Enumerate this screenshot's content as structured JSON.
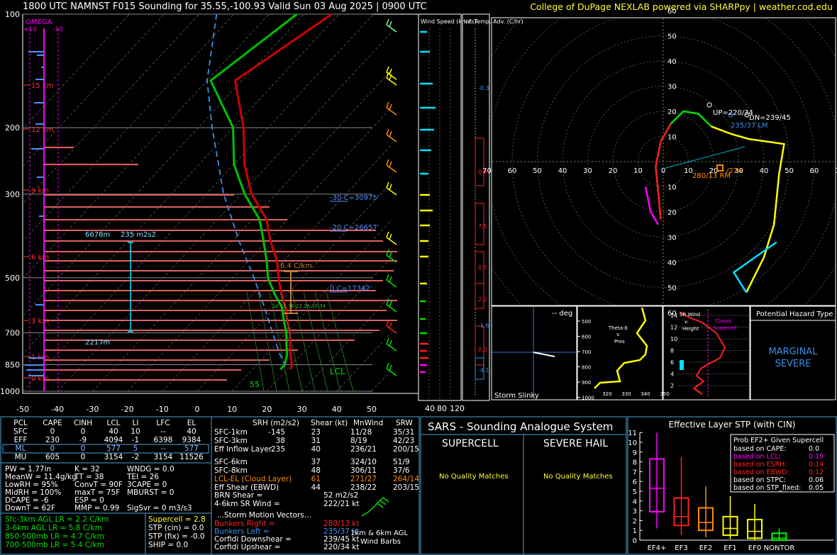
{
  "header": {
    "title": "1800 UTC NAMNST F015 Sounding for 35.55,-100.93 Valid  Sun 03 Aug 2025 | 0900 UTC",
    "credit": "College of DuPage NEXLAB powered via SHARPpy | weather.cod.edu"
  },
  "skewt": {
    "omega_label": "OMEGA",
    "omega_ticks": [
      "+10",
      "-10"
    ],
    "pressure_levels": [
      "100",
      "200",
      "300",
      "500",
      "700",
      "850",
      "1000"
    ],
    "temp_ticks": [
      "-50",
      "-40",
      "-30",
      "-20",
      "-10",
      "0",
      "10",
      "20",
      "30",
      "40",
      "50"
    ],
    "height_labels": [
      "15 km",
      "12 km",
      "9 km",
      "6 km",
      "3 km",
      "1 km",
      "0 km"
    ],
    "annotations": {
      "m30": "-30 C=30975'",
      "m20": "-20 C=26657'",
      "zero": "0 C=17342'",
      "lapse": "6.4 C/km",
      "eff_top": "6678m",
      "eff_srh": "235 m2s2",
      "eff_bot": "2217m",
      "lcl": "LCL",
      "surface_dewpoint": "55"
    },
    "theta_labels": [
      "10",
      "14",
      "18",
      "22",
      "26",
      "30",
      "34"
    ]
  },
  "windspeed_panel": {
    "title": "Wind Speed (knots)",
    "ticks": [
      "40",
      "80",
      "120"
    ]
  },
  "tadv_panel": {
    "title": "Inf. Temp. Adv. (C/hr)",
    "values": [
      "-0.3",
      "0.9",
      "7.5",
      "0.7",
      "2.2",
      "-1.6",
      "0.3",
      "-4.1"
    ]
  },
  "hodograph": {
    "rings": [
      "10",
      "20",
      "30",
      "40",
      "50",
      "60"
    ],
    "x_ticks": [
      "70",
      "60",
      "50",
      "40",
      "30",
      "20",
      "10",
      "0",
      "10",
      "20",
      "30",
      "40",
      "50",
      "60",
      "70"
    ],
    "up_label": "UP=220/34",
    "dn_label": "DN=239/45",
    "lm_label": "235/37 LM",
    "rm_label": "280/13 RM",
    "misc_label": "/274"
  },
  "slinky": {
    "deg": "-- deg",
    "label": "Storm Slinky"
  },
  "thetae": {
    "label": "Theta-E v. Pres",
    "y_ticks": [
      "500",
      "600",
      "700",
      "800",
      "900",
      "1000"
    ],
    "x_ticks": [
      "320",
      "330",
      "340",
      "350"
    ]
  },
  "srwind": {
    "label": "SR Wind v. Height",
    "classic": "Classic Supercell",
    "y_ticks": [
      "14",
      "12",
      "10",
      "8",
      "6",
      "4",
      "2"
    ]
  },
  "hazard": {
    "title": "Potential Hazard Type",
    "value_line1": "MARGINAL",
    "value_line2": "SEVERE"
  },
  "parcels": {
    "headers": [
      "PCL",
      "CAPE",
      "CINH",
      "LCL",
      "LI",
      "LFC",
      "EL"
    ],
    "rows": [
      [
        "SFC",
        "0",
        "0",
        "40",
        "10",
        "--",
        "40"
      ],
      [
        "EFF",
        "230",
        "-9",
        "4094",
        "-1",
        "6398",
        "9384"
      ],
      [
        "ML",
        "0",
        "0",
        "577",
        "5",
        "--",
        "577"
      ],
      [
        "MU",
        "605",
        "0",
        "3154",
        "-2",
        "3154",
        "11526"
      ]
    ]
  },
  "indices": {
    "col1": [
      "PW = 1.77in",
      "MeanW = 11.4g/kg",
      "LowRH = 95%",
      "MidRH = 100%",
      "DCAPE = -6",
      "DownT = 62F"
    ],
    "col2": [
      "K = 32",
      "TT = 38",
      "ConvT = 90F",
      "maxT = 75F",
      "ESP = 0",
      "MMP = 0.99"
    ],
    "col3": [
      "WNDG = 0.0",
      "TEI = 26",
      "3CAPE = 0",
      "MBURST = 0",
      "",
      "SigSvr = 0 m3/s3"
    ]
  },
  "lapse_rates": [
    "Sfc-3km AGL LR = 2.2 C/km",
    "3-6km AGL LR = 5.8 C/km",
    "850-500mb LR = 4.7 C/km",
    "700-500mb LR = 5.4 C/km"
  ],
  "composites": [
    "Supercell = 2.8",
    "STP (cin) = 0.0",
    "STP (fix) = -0.0",
    "SHIP = 0.0"
  ],
  "kinematics": {
    "headers": [
      "SRH (m2/s2)",
      "Shear (kt)",
      "MnWind",
      "SRW"
    ],
    "rows": [
      [
        "SFC-1km",
        "-145",
        "23",
        "11/28",
        "35/31"
      ],
      [
        "SFC-3km",
        "38",
        "31",
        "8/19",
        "42/23"
      ],
      [
        "Eff Inflow Layer",
        "235",
        "40",
        "236/21",
        "200/15"
      ],
      [
        "SFC-6km",
        "37",
        "324/10",
        "51/9"
      ],
      [
        "SFC-8km",
        "48",
        "306/11",
        "37/6"
      ],
      [
        "LCL-EL (Cloud Layer)",
        "61",
        "271/27",
        "264/14"
      ],
      [
        "Eff Shear (EBWD)",
        "44",
        "238/22",
        "203/15"
      ]
    ],
    "brn": [
      "BRN Shear =",
      "52 m2/s2"
    ],
    "sr46": [
      "4-6km SR Wind =",
      "222/21 kt"
    ],
    "storm_title": "...Storm Motion Vectors...",
    "storm": [
      [
        "Bunkers Right =",
        "280/13 kt"
      ],
      [
        "Bunkers Left =",
        "235/37 kt"
      ],
      [
        "Corfidi Downshear =",
        "239/45 kt"
      ],
      [
        "Corfidi Upshear =",
        "220/34 kt"
      ]
    ],
    "barb_caption": "1km & 6km AGL Wind Barbs"
  },
  "sars": {
    "title": "SARS - Sounding Analogue System",
    "supercell": "SUPERCELL",
    "hail": "SEVERE HAIL",
    "no_match": "No Quality Matches"
  },
  "stp": {
    "title": "Effective Layer STP (with CIN)",
    "legend_title": "Prob EF2+ Given Supercell",
    "legend": [
      [
        "based on CAPE:",
        "0.0"
      ],
      [
        "based on LCL:",
        "0.19"
      ],
      [
        "based on ESRH:",
        "0.14"
      ],
      [
        "based on EBWD:",
        "0.12"
      ],
      [
        "based on STPC:",
        "0.06"
      ],
      [
        "based on STP_fixed:",
        "0.05"
      ]
    ],
    "y_ticks": [
      "11",
      "10",
      "9",
      "8",
      "7",
      "6",
      "5",
      "4",
      "3",
      "2",
      "1",
      "0"
    ]
  },
  "chart_data": [
    {
      "type": "line",
      "chart": "skewt",
      "series": [
        {
          "name": "",
          "color": "#d00000",
          "pressure": [
            100,
            150,
            200,
            250,
            300,
            350,
            400,
            450,
            500,
            550,
            600,
            650,
            700,
            750,
            800,
            850,
            875
          ],
          "temp": [
            -62,
            -72,
            -57,
            -47,
            -37,
            -26,
            -19,
            -12,
            -7,
            -2,
            3,
            7,
            11,
            14,
            17,
            20,
            21
          ]
        },
        {
          "name": "",
          "color": "#00c000",
          "pressure": [
            100,
            150,
            200,
            250,
            300,
            350,
            400,
            450,
            500,
            550,
            600,
            650,
            700,
            750,
            800,
            850,
            875
          ],
          "temp": [
            -72,
            -79,
            -60,
            -50,
            -39,
            -28,
            -21,
            -15,
            -10,
            -4,
            2,
            6,
            10,
            13,
            16,
            18,
            18
          ]
        },
        {
          "name": "",
          "color": "#3a8ee8",
          "pressure": [
            100,
            150,
            200,
            300,
            400,
            500,
            600,
            700,
            800,
            850
          ],
          "temp": [
            -95,
            -80,
            -66,
            -45,
            -28,
            -14,
            -3,
            6,
            14,
            18
          ]
        }
      ],
      "ylim": [
        100,
        1000
      ],
      "xlim": [
        -50,
        50
      ]
    },
    {
      "type": "line",
      "chart": "hodograph",
      "series": [
        {
          "name": "",
          "color": "#ff2020",
          "points": [
            [
              -1,
              -23
            ],
            [
              -2,
              -12
            ],
            [
              -3,
              -2
            ],
            [
              -1,
              8
            ],
            [
              3,
              15
            ]
          ]
        },
        {
          "name": "",
          "color": "#00e000",
          "points": [
            [
              3,
              15
            ],
            [
              8,
              20
            ],
            [
              14,
              19
            ],
            [
              19,
              14
            ]
          ]
        },
        {
          "name": "",
          "color": "#ffff00",
          "points": [
            [
              19,
              14
            ],
            [
              27,
              11
            ],
            [
              34,
              9
            ],
            [
              48,
              7
            ],
            [
              46,
              -5
            ],
            [
              44,
              -25
            ],
            [
              40,
              -38
            ],
            [
              33,
              -52
            ]
          ]
        },
        {
          "name": "",
          "color": "#00e0ff",
          "points": [
            [
              33,
              -52
            ],
            [
              28,
              -44
            ],
            [
              45,
              -32
            ]
          ]
        },
        {
          "name": "",
          "color": "#ff00ff",
          "points": [
            [
              -7,
              -10
            ],
            [
              -5,
              -20
            ],
            [
              -2,
              -25
            ]
          ]
        }
      ]
    },
    {
      "type": "bar",
      "chart": "stp_boxplot",
      "categories": [
        "EF4+",
        "EF3",
        "EF2",
        "EF1",
        "EF0",
        "NONTOR"
      ],
      "boxes": [
        {
          "min": 1.2,
          "q1": 2.9,
          "median": 5.3,
          "q3": 8.3,
          "max": 11.0
        },
        {
          "min": 0.5,
          "q1": 1.5,
          "median": 2.4,
          "q3": 4.3,
          "max": 8.5
        },
        {
          "min": 0.3,
          "q1": 1.0,
          "median": 1.8,
          "q3": 3.3,
          "max": 5.5
        },
        {
          "min": 0.1,
          "q1": 0.5,
          "median": 1.2,
          "q3": 2.4,
          "max": 4.5
        },
        {
          "min": 0.0,
          "q1": 0.2,
          "median": 0.9,
          "q3": 2.1,
          "max": 3.7
        },
        {
          "min": 0.0,
          "q1": 0.0,
          "median": 0.2,
          "q3": 0.7,
          "max": 1.2
        }
      ],
      "colors": [
        "#ff00ff",
        "#ff2020",
        "#ff8c00",
        "#ffff00",
        "#ffff00",
        "#00ff00"
      ],
      "ylim": [
        0,
        11
      ]
    }
  ]
}
